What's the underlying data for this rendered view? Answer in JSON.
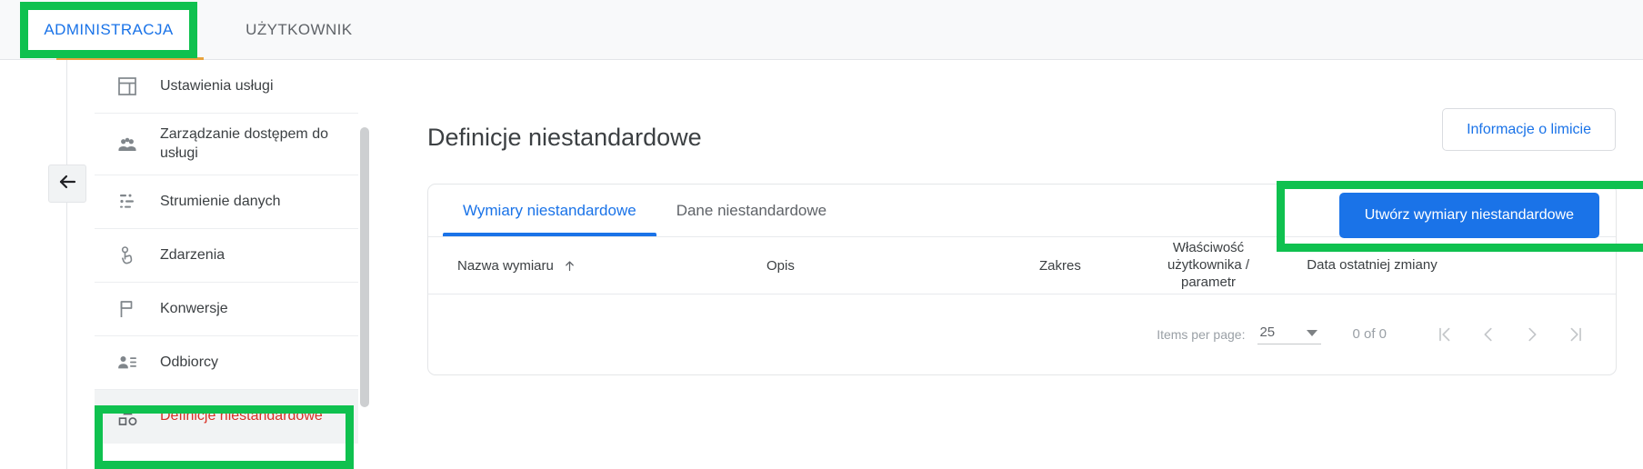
{
  "topbar": {
    "tabs": [
      {
        "label": "ADMINISTRACJA",
        "active": true
      },
      {
        "label": "UŻYTKOWNIK",
        "active": false
      }
    ]
  },
  "collapse": {
    "icon": "arrow-left-icon"
  },
  "sidebar": {
    "items": [
      {
        "label": "Ustawienia usługi",
        "icon": "layout-icon",
        "selected": false
      },
      {
        "label": "Zarządzanie dostępem do usługi",
        "icon": "people-icon",
        "selected": false
      },
      {
        "label": "Strumienie danych",
        "icon": "data-streams-icon",
        "selected": false
      },
      {
        "label": "Zdarzenia",
        "icon": "tap-hand-icon",
        "selected": false
      },
      {
        "label": "Konwersje",
        "icon": "flag-icon",
        "selected": false
      },
      {
        "label": "Odbiorcy",
        "icon": "audience-icon",
        "selected": false
      },
      {
        "label": "Definicje niestandardowe",
        "icon": "shapes-icon",
        "selected": true
      }
    ]
  },
  "main": {
    "page_title": "Definicje niestandardowe",
    "limit_button": "Informacje o limicie",
    "tabs": [
      {
        "label": "Wymiary niestandardowe",
        "active": true
      },
      {
        "label": "Dane niestandardowe",
        "active": false
      }
    ],
    "create_button": "Utwórz wymiary niestandardowe",
    "table": {
      "columns": [
        {
          "label": "Nazwa wymiaru",
          "sorted": true,
          "sort_icon": "arrow-up-icon"
        },
        {
          "label": "Opis",
          "sorted": false
        },
        {
          "label": "Zakres",
          "sorted": false
        },
        {
          "label": "Właściwość użytkownika / parametr",
          "sorted": false
        },
        {
          "label": "Data ostatniej zmiany",
          "sorted": false
        }
      ],
      "rows": []
    },
    "pager": {
      "items_per_page_label": "Items per page:",
      "items_per_page_value": "25",
      "range_label": "0 of 0",
      "buttons": [
        {
          "name": "first-page",
          "glyph": "|‹"
        },
        {
          "name": "previous-page",
          "glyph": "‹"
        },
        {
          "name": "next-page",
          "glyph": "›"
        },
        {
          "name": "last-page",
          "glyph": "›|"
        }
      ]
    }
  },
  "highlights": {
    "color": "#0fc14f",
    "boxes": [
      {
        "name": "administracja-tab-highlight"
      },
      {
        "name": "definicje-niestandardowe-nav-highlight"
      },
      {
        "name": "create-custom-dimensions-highlight"
      }
    ]
  }
}
